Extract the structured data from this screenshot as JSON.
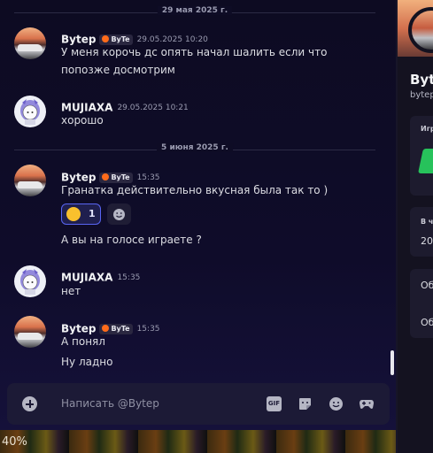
{
  "chat": {
    "dividers": [
      "29 мая 2025 г.",
      "5 июня 2025 г."
    ],
    "messages": [
      {
        "author": "Bytep",
        "clan_tag": "ByTe",
        "timestamp": "29.05.2025 10:20",
        "lines": [
          "У меня корочь дс опять начал шалить если что",
          "попозже досмотрим"
        ]
      },
      {
        "author": "MUJIAXA",
        "timestamp": "29.05.2025 10:21",
        "lines": [
          "хорошо"
        ]
      },
      {
        "author": "Bytep",
        "clan_tag": "ByTe",
        "timestamp": "15:35",
        "lines": [
          "Гранатка действительно вкусная была так то )",
          "А вы на голосе играете ?"
        ],
        "reaction": {
          "emoji": "rolling-on-floor-laughing",
          "count": "1"
        }
      },
      {
        "author": "MUJIAXA",
        "timestamp": "15:35",
        "lines": [
          "нет"
        ]
      },
      {
        "author": "Bytep",
        "clan_tag": "ByTe",
        "timestamp": "15:35",
        "lines": [
          "А понял",
          "Ну ладно"
        ]
      }
    ]
  },
  "composer": {
    "placeholder": "Написать @Bytep",
    "gif_label": "GIF",
    "icons": [
      "add-attachment-icon",
      "gif-icon",
      "sticker-icon",
      "emoji-icon",
      "activities-icon"
    ]
  },
  "profile": {
    "name": "Byt",
    "tag": "bytep",
    "section_playing": "Игр",
    "section_member": "В ч",
    "member_value": "20",
    "row1": "Об",
    "row2": "Об"
  },
  "game_bar": {
    "text": "40%"
  },
  "colors": {
    "accent": "#5865f2",
    "chat_bg": "#0e0c25",
    "composer_bg": "#1c1a36",
    "reaction_bg": "#1f1f4e",
    "clan_icon": "#ff6b1a"
  }
}
